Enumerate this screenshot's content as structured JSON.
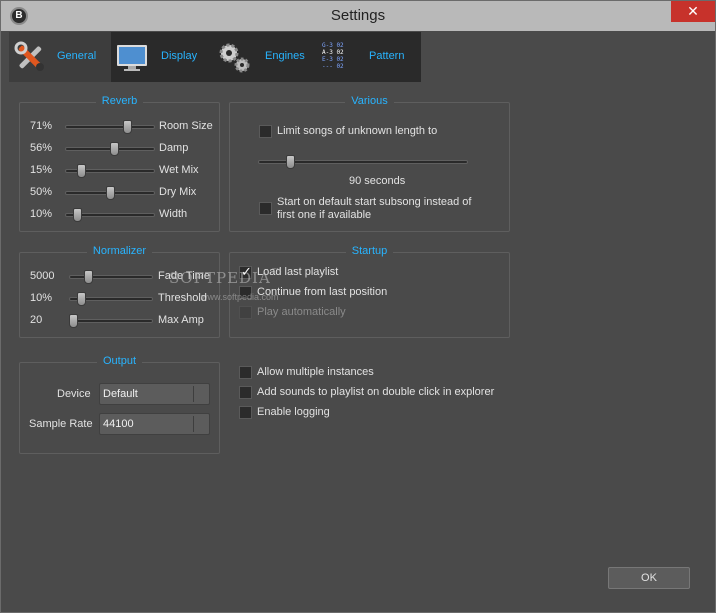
{
  "window": {
    "title": "Settings",
    "app_icon_letter": "B",
    "close_glyph": "✕"
  },
  "tabs": [
    {
      "label": "General",
      "icon": "tools-icon",
      "active": true
    },
    {
      "label": "Display",
      "icon": "monitor-icon",
      "active": false
    },
    {
      "label": "Engines",
      "icon": "gears-icon",
      "active": false
    },
    {
      "label": "Pattern",
      "icon": "pattern-icon",
      "active": false
    }
  ],
  "reverb": {
    "title": "Reverb",
    "rows": [
      {
        "value": "71%",
        "label": "Room Size",
        "level": 0.71
      },
      {
        "value": "56%",
        "label": "Damp",
        "level": 0.56
      },
      {
        "value": "15%",
        "label": "Wet Mix",
        "level": 0.15
      },
      {
        "value": "50%",
        "label": "Dry Mix",
        "level": 0.5
      },
      {
        "value": "10%",
        "label": "Width",
        "level": 0.1
      }
    ]
  },
  "various": {
    "title": "Various",
    "limit_songs_label": "Limit songs of unknown length to",
    "limit_checked": false,
    "seconds_text": "90 seconds",
    "seconds_level": 0.14,
    "default_subsong_label_line1": "Start on default start subsong instead of",
    "default_subsong_label_line2": "first one if available",
    "default_subsong_checked": false
  },
  "normalizer": {
    "title": "Normalizer",
    "rows": [
      {
        "value": "5000",
        "label": "Fade Time",
        "level": 0.2
      },
      {
        "value": "10%",
        "label": "Threshold",
        "level": 0.1
      },
      {
        "value": "20",
        "label": "Max Amp",
        "level": 0.0
      }
    ]
  },
  "startup": {
    "title": "Startup",
    "items": [
      {
        "label": "Load last playlist",
        "checked": true,
        "disabled": false
      },
      {
        "label": "Continue from last position",
        "checked": false,
        "disabled": false
      },
      {
        "label": "Play automatically",
        "checked": false,
        "disabled": true
      }
    ]
  },
  "output": {
    "title": "Output",
    "device_label": "Device",
    "device_value": "Default",
    "sample_rate_label": "Sample Rate",
    "sample_rate_value": "44100"
  },
  "misc": [
    {
      "label": "Allow multiple instances",
      "checked": false
    },
    {
      "label": "Add sounds to playlist on double click in explorer",
      "checked": false
    },
    {
      "label": "Enable logging",
      "checked": false
    }
  ],
  "ok_label": "OK",
  "watermark": {
    "text": "SOFTPEDIA",
    "trademark": "™",
    "url": "www.softpedia.com"
  },
  "colors": {
    "accent": "#28b4ff",
    "background": "#4a4a4a",
    "titlebar": "#b9b9b9",
    "close": "#c7322b"
  }
}
